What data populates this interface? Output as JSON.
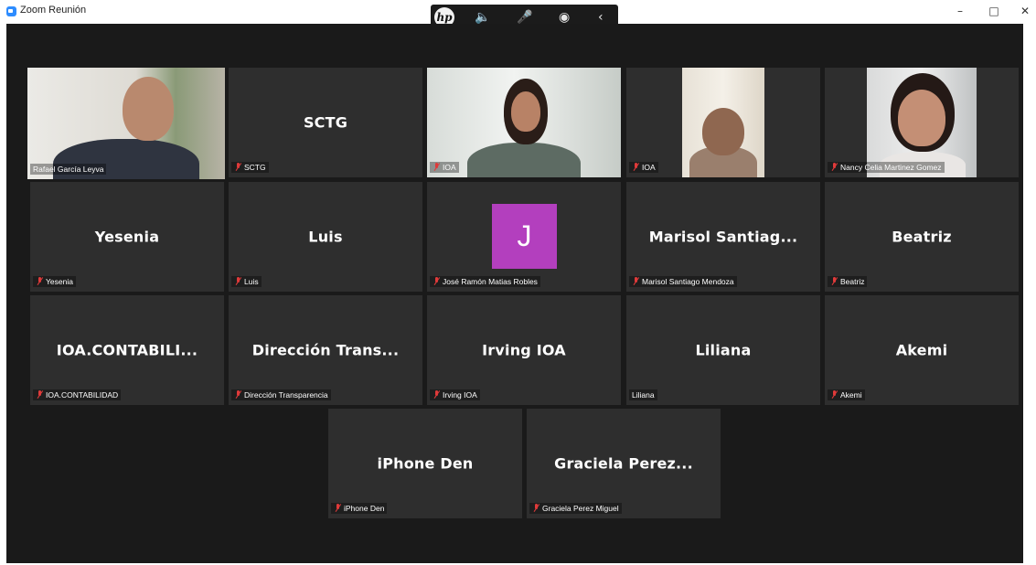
{
  "window": {
    "title": "Zoom Reunión"
  },
  "hp_toolbar": {
    "logo": "hp"
  },
  "participants": [
    {
      "name": "Rafael García Leyva",
      "display": "",
      "muted": false,
      "video": true
    },
    {
      "name": "SCTG",
      "display": "SCTG",
      "muted": true,
      "video": false
    },
    {
      "name": "IOA",
      "display": "",
      "muted": true,
      "video": true
    },
    {
      "name": "IOA",
      "display": "",
      "muted": true,
      "video": true
    },
    {
      "name": "Nancy Celia Martinez Gomez",
      "display": "",
      "muted": true,
      "video": true
    },
    {
      "name": "Yesenia",
      "display": "Yesenia",
      "muted": true,
      "video": false
    },
    {
      "name": "Luis",
      "display": "Luis",
      "muted": true,
      "video": false
    },
    {
      "name": "José Ramón Matias Robles",
      "display": "J",
      "muted": true,
      "video": false
    },
    {
      "name": "Marisol Santiago Mendoza",
      "display": "Marisol  Santiag...",
      "muted": true,
      "video": false
    },
    {
      "name": "Beatriz",
      "display": "Beatriz",
      "muted": true,
      "video": false
    },
    {
      "name": "IOA.CONTABILIDAD",
      "display": "IOA.CONTABILI...",
      "muted": true,
      "video": false
    },
    {
      "name": "Dirección Transparencia",
      "display": "Dirección  Trans...",
      "muted": true,
      "video": false
    },
    {
      "name": "Irving IOA",
      "display": "Irving IOA",
      "muted": true,
      "video": false
    },
    {
      "name": "Liliana",
      "display": "Liliana",
      "muted": false,
      "video": false
    },
    {
      "name": "Akemi",
      "display": "Akemi",
      "muted": true,
      "video": false
    },
    {
      "name": "iPhone Den",
      "display": "iPhone Den",
      "muted": true,
      "video": false
    },
    {
      "name": "Graciela Perez Miguel",
      "display": "Graciela  Perez...",
      "muted": true,
      "video": false
    }
  ],
  "colors": {
    "active_speaker_border": "#c3d83c",
    "avatar_bg": "#b33fbe",
    "tile_bg": "#2e2e2e",
    "stage_bg": "#1a1a1a"
  }
}
